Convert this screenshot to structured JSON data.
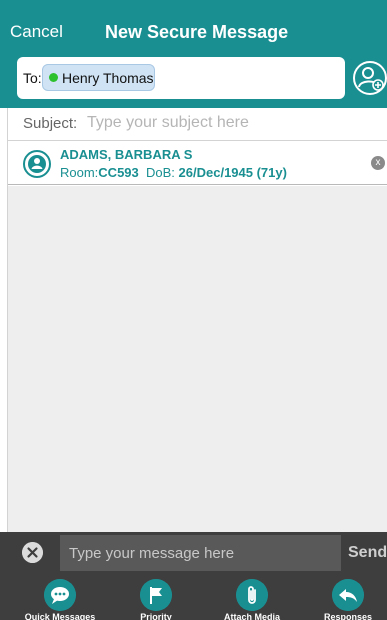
{
  "header": {
    "cancel_label": "Cancel",
    "title": "New Secure Message"
  },
  "recipients": {
    "to_label": "To:",
    "items": [
      {
        "name": "Henry Thomas",
        "status_color": "#2ec12e"
      }
    ],
    "add_icon": "add-contact-icon"
  },
  "subject": {
    "label": "Subject:",
    "placeholder": "Type your subject here",
    "value": ""
  },
  "patient": {
    "name": "ADAMS, BARBARA S",
    "room_label": "Room:",
    "room": "CC593",
    "dob_label": "DoB:",
    "dob": "26/Dec/1945 (71y)",
    "remove_label": "x"
  },
  "composer": {
    "placeholder": "Type your message here",
    "value": "",
    "send_label": "Send"
  },
  "toolbar": {
    "items": [
      {
        "label": "Quick Messages",
        "icon": "chat-bubble-icon"
      },
      {
        "label": "Priority",
        "icon": "flag-icon"
      },
      {
        "label": "Attach Media",
        "icon": "paperclip-icon"
      },
      {
        "label": "Responses",
        "icon": "reply-icon"
      }
    ]
  },
  "colors": {
    "brand": "#1a8f92",
    "bottom_bar": "#3e3e3e",
    "chip_bg": "#cfe3f4"
  }
}
